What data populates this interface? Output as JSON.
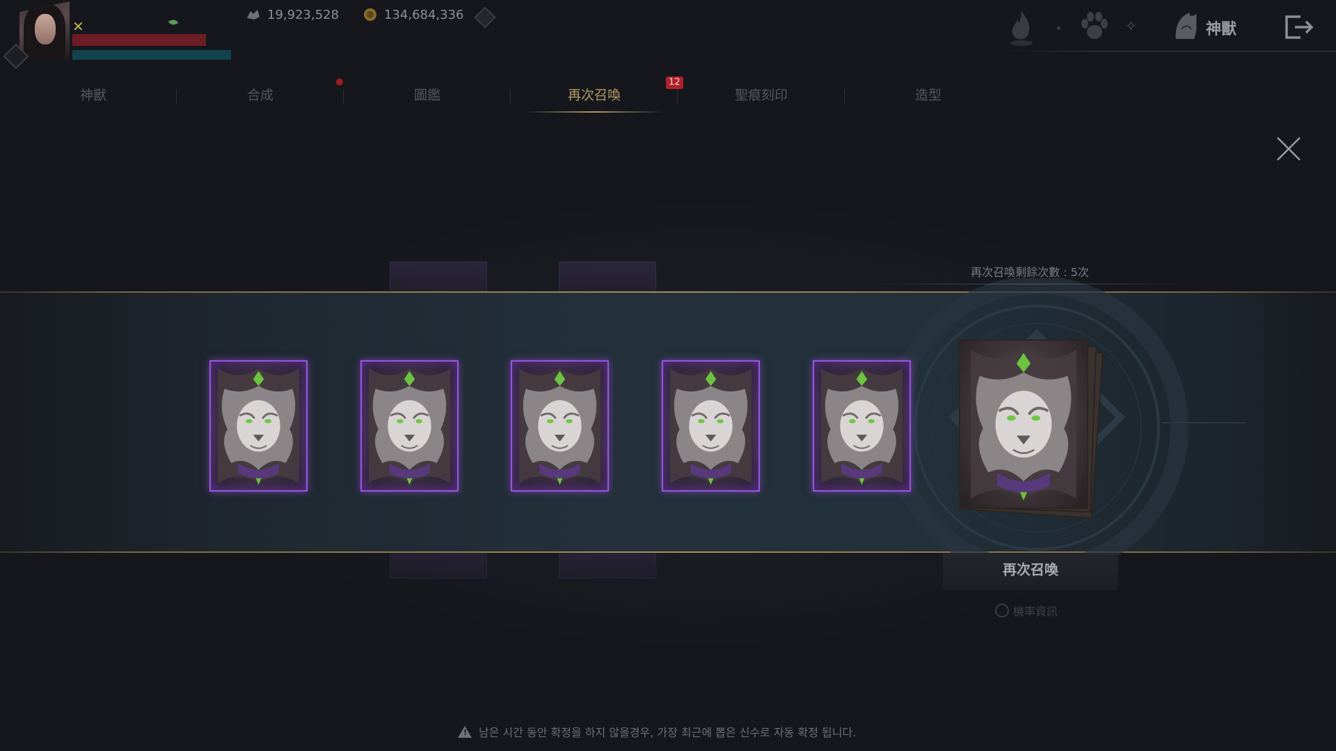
{
  "currencies": [
    {
      "icon": "wolf-coin-icon",
      "value": "19,923,528"
    },
    {
      "icon": "gold-coin-icon",
      "value": "134,684,336"
    }
  ],
  "header": {
    "title": "神獸"
  },
  "tabs": [
    {
      "label": "神獸"
    },
    {
      "label": "合成"
    },
    {
      "label": "圖鑑"
    },
    {
      "label": "再次召喚",
      "badge": "12"
    },
    {
      "label": "聖痕刻印"
    },
    {
      "label": "造型"
    }
  ],
  "active_tab": "再次召喚",
  "summon": {
    "remaining_text": "再次召喚剩餘次數 : 5次",
    "resummon_button": "再次召喚",
    "probability_info": "機率資訊",
    "card_count": 5
  },
  "notice": "남은 시간 동안 확정을 하지 않을경우, 가장 최근에 뽑은 신수로 자동 확정 됩니다.",
  "colors": {
    "accent_gold": "#b59a63",
    "card_border": "#9a55e0",
    "badge_red": "#b0222a"
  }
}
